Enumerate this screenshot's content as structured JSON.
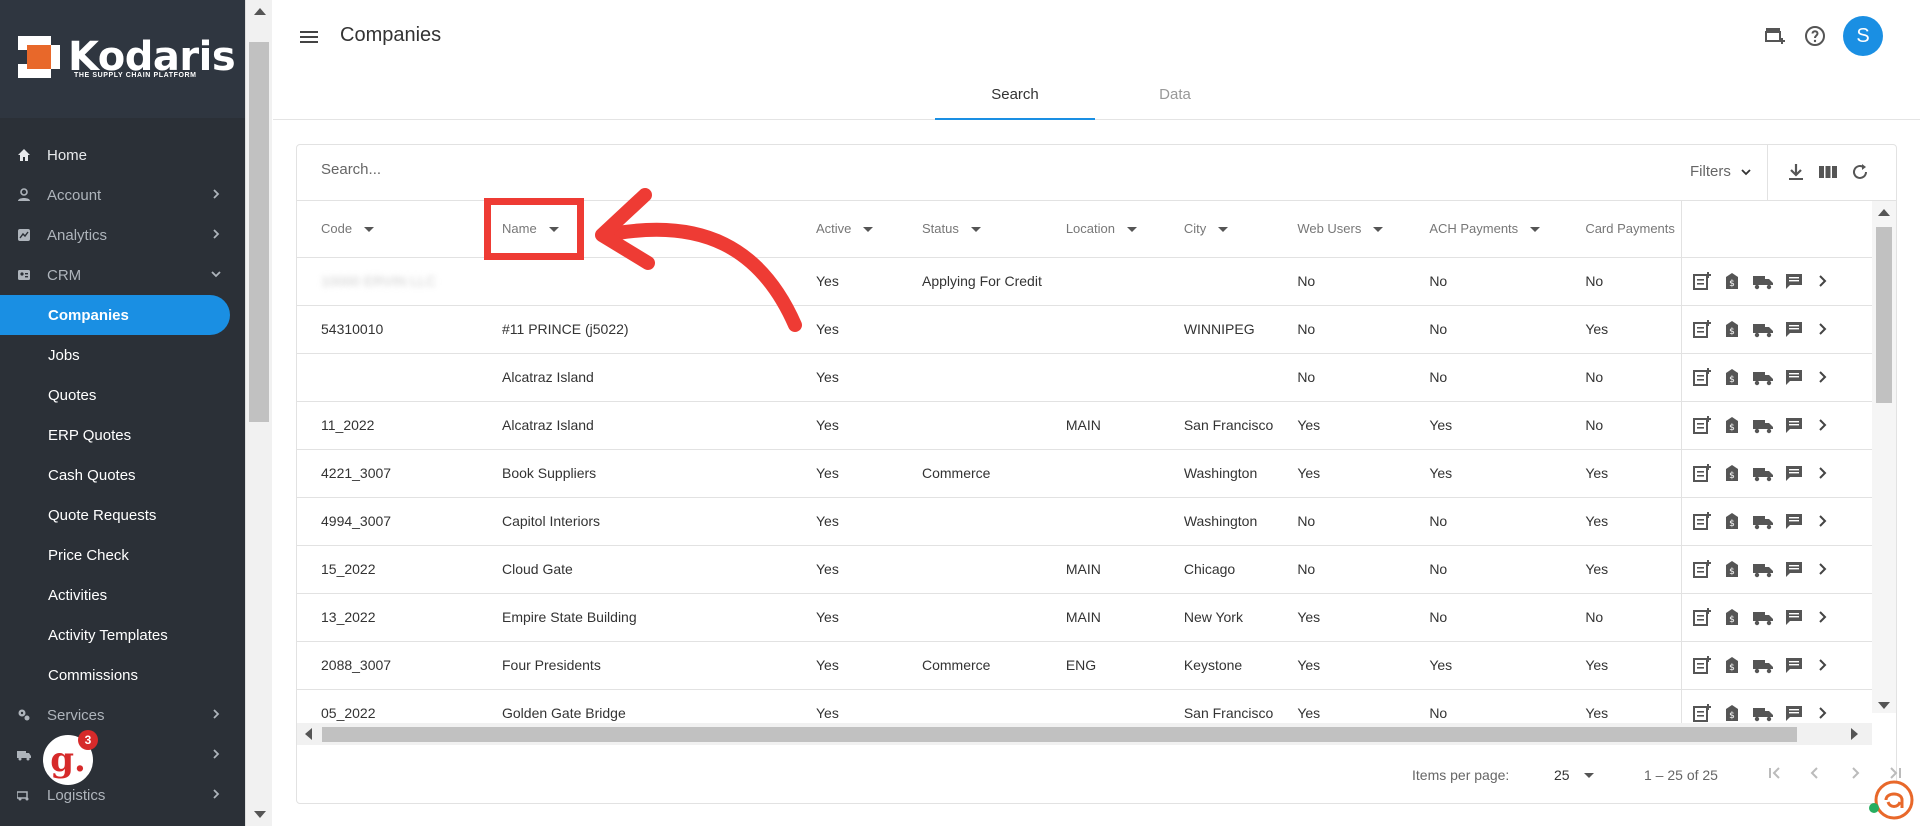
{
  "brand": {
    "name": "Kodaris",
    "tagline": "THE SUPPLY CHAIN PLATFORM",
    "accent": "#1a8fe3",
    "logo_orange": "#e8682a"
  },
  "sidebar": {
    "items": [
      {
        "label": "Home",
        "icon": "home-icon",
        "chevron": false
      },
      {
        "label": "Account",
        "icon": "person-icon",
        "chevron": true
      },
      {
        "label": "Analytics",
        "icon": "chart-icon",
        "chevron": true
      },
      {
        "label": "CRM",
        "icon": "crm-icon",
        "chevron": true,
        "expanded": true
      }
    ],
    "crm_children": [
      "Companies",
      "Jobs",
      "Quotes",
      "ERP Quotes",
      "Cash Quotes",
      "Quote Requests",
      "Price Check",
      "Activities",
      "Activity Templates",
      "Commissions"
    ],
    "active_child": "Companies",
    "bottom_items": [
      {
        "label": "Services",
        "icon": "services-icon"
      },
      {
        "label": "",
        "icon": "truck-icon"
      },
      {
        "label": "Logistics",
        "icon": "logistics-icon"
      }
    ]
  },
  "header": {
    "title": "Companies",
    "avatar_letter": "S",
    "tabs": [
      "Search",
      "Data"
    ],
    "active_tab": "Search"
  },
  "search": {
    "placeholder": "Search...",
    "filters_label": "Filters"
  },
  "table": {
    "columns": [
      "Code",
      "Name",
      "Active",
      "Status",
      "Location",
      "City",
      "Web Users",
      "ACH Payments",
      "Card Payments"
    ],
    "rows": [
      [
        "10000 ERVIN LLC",
        "",
        "Yes",
        "Applying For Credit",
        "",
        "",
        "No",
        "No",
        "No"
      ],
      [
        "54310010",
        "#11 PRINCE (j5022)",
        "Yes",
        "",
        "",
        "WINNIPEG",
        "No",
        "No",
        "Yes"
      ],
      [
        "",
        "Alcatraz Island",
        "Yes",
        "",
        "",
        "",
        "No",
        "No",
        "No"
      ],
      [
        "11_2022",
        "Alcatraz Island",
        "Yes",
        "",
        "MAIN",
        "San Francisco",
        "Yes",
        "Yes",
        "No"
      ],
      [
        "4221_3007",
        "Book Suppliers",
        "Yes",
        "Commerce",
        "",
        "Washington",
        "Yes",
        "Yes",
        "Yes"
      ],
      [
        "4994_3007",
        "Capitol Interiors",
        "Yes",
        "",
        "",
        "Washington",
        "No",
        "No",
        "Yes"
      ],
      [
        "15_2022",
        "Cloud Gate",
        "Yes",
        "",
        "MAIN",
        "Chicago",
        "No",
        "No",
        "Yes"
      ],
      [
        "13_2022",
        "Empire State Building",
        "Yes",
        "",
        "MAIN",
        "New York",
        "Yes",
        "No",
        "No"
      ],
      [
        "2088_3007",
        "Four Presidents",
        "Yes",
        "Commerce",
        "ENG",
        "Keystone",
        "Yes",
        "Yes",
        "Yes"
      ],
      [
        "05_2022",
        "Golden Gate Bridge",
        "Yes",
        "",
        "",
        "San Francisco",
        "Yes",
        "No",
        "Yes"
      ]
    ]
  },
  "paginator": {
    "items_per_page_label": "Items per page:",
    "page_size": "25",
    "range_label": "1 – 25 of 25"
  },
  "widgets": {
    "guide_badge_count": "3",
    "guide_letter": "g."
  }
}
